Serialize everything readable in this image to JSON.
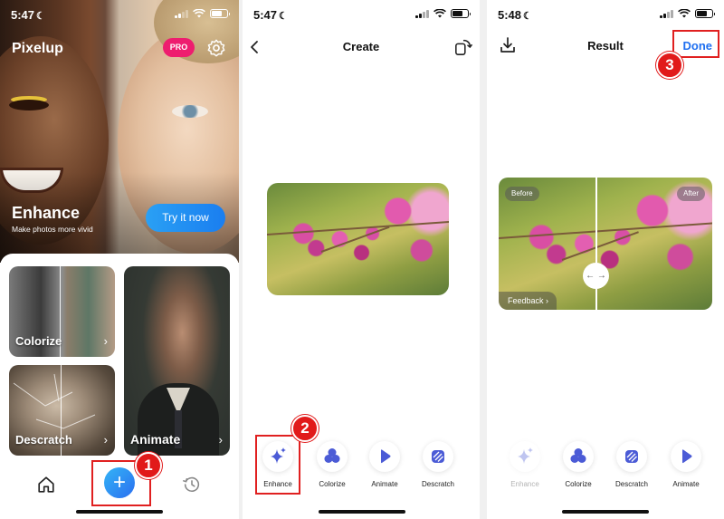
{
  "panel1": {
    "status": {
      "time": "5:47"
    },
    "brand": "Pixelup",
    "pro_badge": "PRO",
    "hero": {
      "title": "Enhance",
      "subtitle": "Make photos more vivid",
      "cta": "Try it now"
    },
    "cards": {
      "colorize": "Colorize",
      "descratch": "Descratch",
      "animate": "Animate"
    },
    "card_arrow": "›",
    "add_label": "+",
    "step": "1"
  },
  "panel2": {
    "status": {
      "time": "5:47"
    },
    "title": "Create",
    "tools": [
      "Enhance",
      "Colorize",
      "Animate",
      "Descratch"
    ],
    "step": "2"
  },
  "panel3": {
    "status": {
      "time": "5:48"
    },
    "title": "Result",
    "done_label": "Done",
    "before_label": "Before",
    "after_label": "After",
    "compare_handle": "← →",
    "feedback_label": "Feedback ›",
    "tools": [
      "Enhance",
      "Colorize",
      "Descratch",
      "Animate"
    ],
    "step": "3"
  },
  "colors": {
    "accent_blue": "#1f6ff0",
    "pro_pink": "#ee1d6f",
    "annotation_red": "#e02020",
    "tool_purple": "#4b5bd6"
  }
}
